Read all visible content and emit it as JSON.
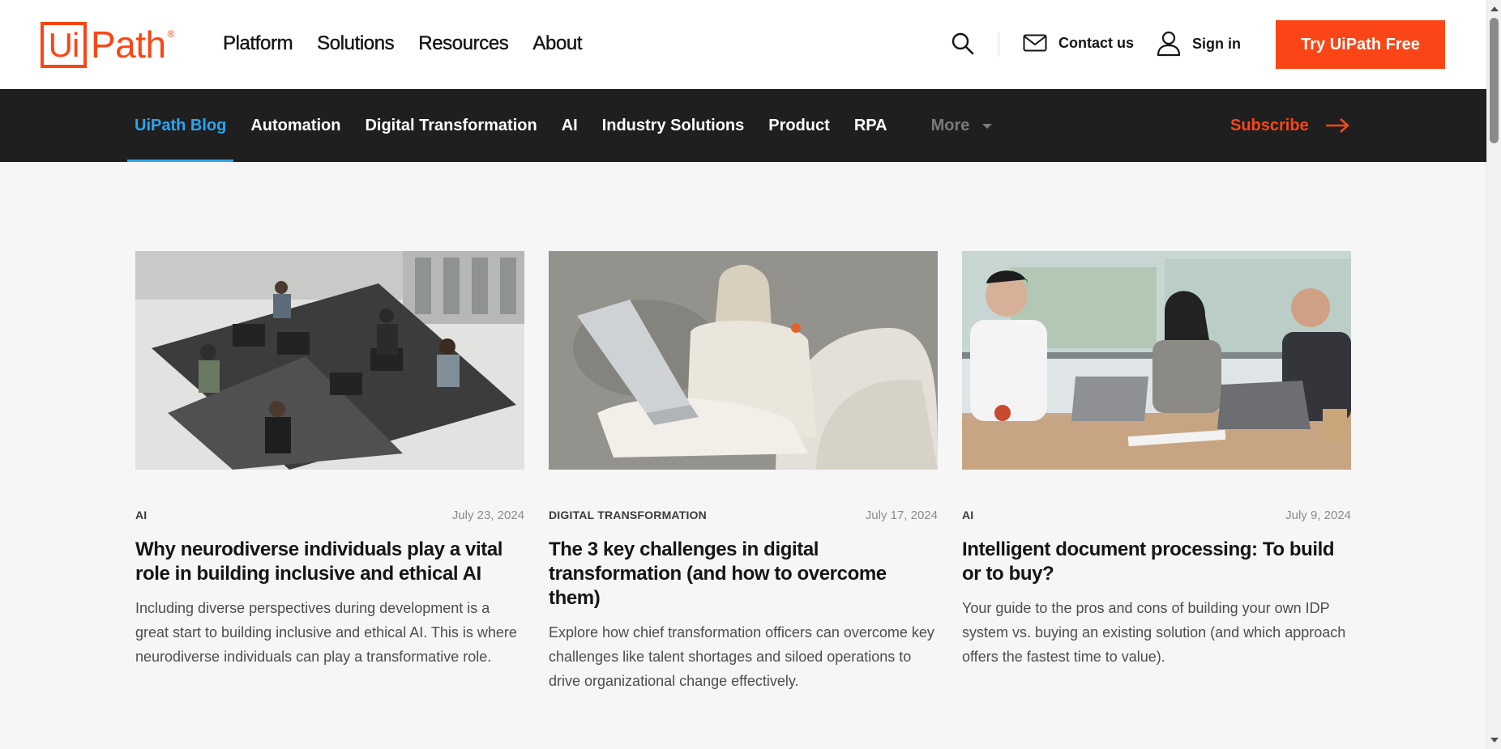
{
  "header": {
    "logo": {
      "box_text": "Ui",
      "text": "Path",
      "reg": "®"
    },
    "nav": [
      {
        "label": "Platform"
      },
      {
        "label": "Solutions"
      },
      {
        "label": "Resources"
      },
      {
        "label": "About"
      }
    ],
    "search_icon": "search-icon",
    "contact_label": "Contact us",
    "signin_label": "Sign in",
    "cta_label": "Try UiPath Free"
  },
  "blog_nav": {
    "items": [
      {
        "label": "UiPath Blog",
        "active": true
      },
      {
        "label": "Automation"
      },
      {
        "label": "Digital Transformation"
      },
      {
        "label": "AI"
      },
      {
        "label": "Industry Solutions"
      },
      {
        "label": "Product"
      },
      {
        "label": "RPA"
      }
    ],
    "more_label": "More",
    "subscribe_label": "Subscribe"
  },
  "cards": [
    {
      "category": "AI",
      "date": "July 23, 2024",
      "title": "Why neurodiverse individuals play a vital role in building inclusive and ethical AI",
      "description": "Including diverse perspectives during development is a great start to building inclusive and ethical AI. This is where neurodiverse individuals can play a transformative role."
    },
    {
      "category": "DIGITAL TRANSFORMATION",
      "date": "July 17, 2024",
      "title": "The 3 key challenges in digital transformation (and how to overcome them)",
      "description": "Explore how chief transformation officers can overcome key challenges like talent shortages and siloed operations to drive organizational change effectively."
    },
    {
      "category": "AI",
      "date": "July 9, 2024",
      "title": "Intelligent document processing: To build or to buy?",
      "description": "Your guide to the pros and cons of building your own IDP system vs. buying an existing solution (and which approach offers the fastest time to value)."
    }
  ],
  "colors": {
    "brand": "#fa4616",
    "active_tab": "#29a6f1",
    "nav_bg": "#1f1f1f",
    "page_bg": "#f6f6f6"
  }
}
